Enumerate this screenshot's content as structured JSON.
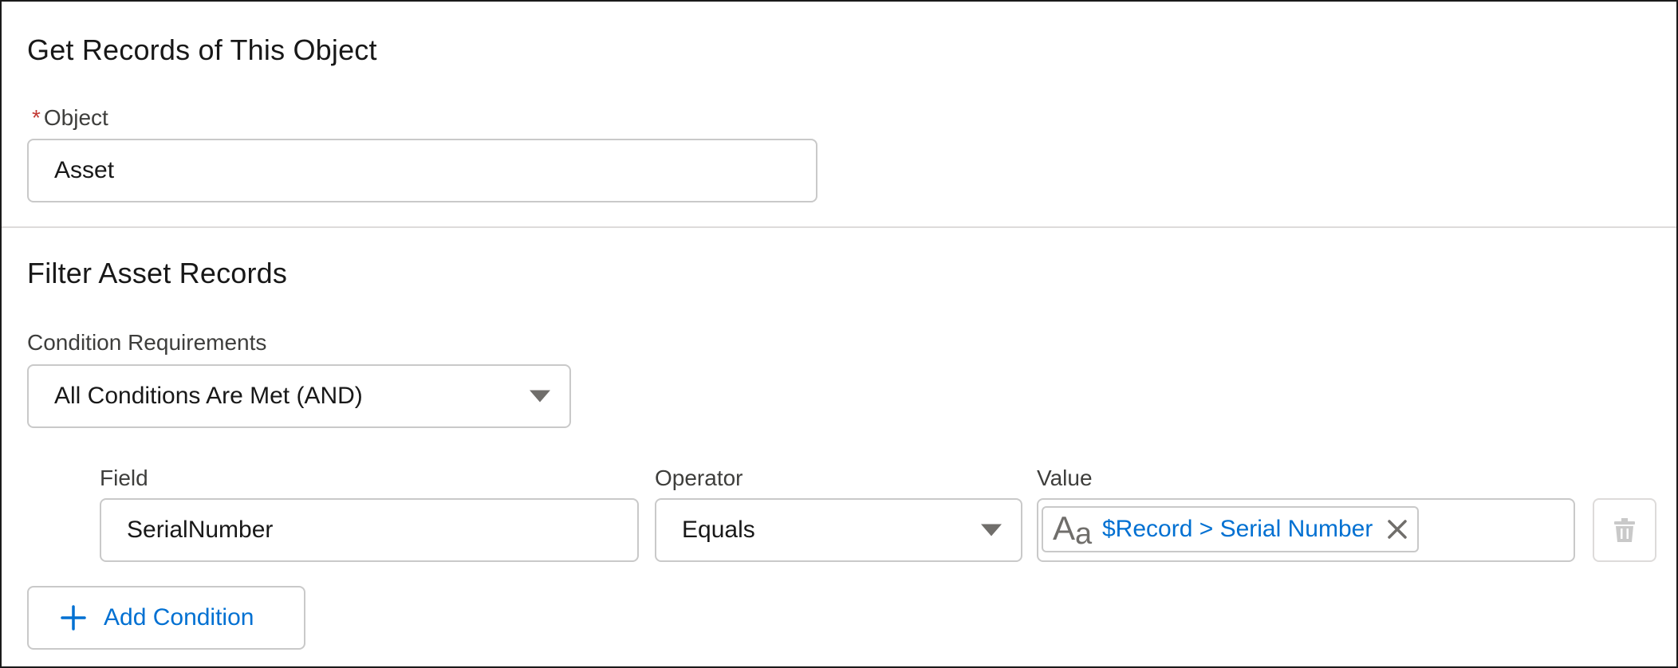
{
  "object_section": {
    "title": "Get Records of This Object",
    "object_label": "Object",
    "required_marker": "*",
    "object_value": "Asset"
  },
  "filter_section": {
    "title": "Filter Asset Records",
    "condition_label": "Condition Requirements",
    "condition_value": "All Conditions Are Met (AND)",
    "columns": {
      "field": "Field",
      "operator": "Operator",
      "value": "Value"
    },
    "conditions": [
      {
        "field": "SerialNumber",
        "operator": "Equals",
        "value_pill": "$Record > Serial Number"
      }
    ],
    "add_condition_label": "Add Condition"
  },
  "icons": {
    "text_type": "text-type-icon",
    "pill_remove": "close-icon",
    "delete": "trash-icon",
    "add": "plus-icon",
    "dropdown": "chevron-down-icon"
  },
  "colors": {
    "accent_blue": "#0070d2",
    "required_red": "#c23934",
    "border": "#c9c9c9",
    "label_gray": "#3e3e3c"
  }
}
